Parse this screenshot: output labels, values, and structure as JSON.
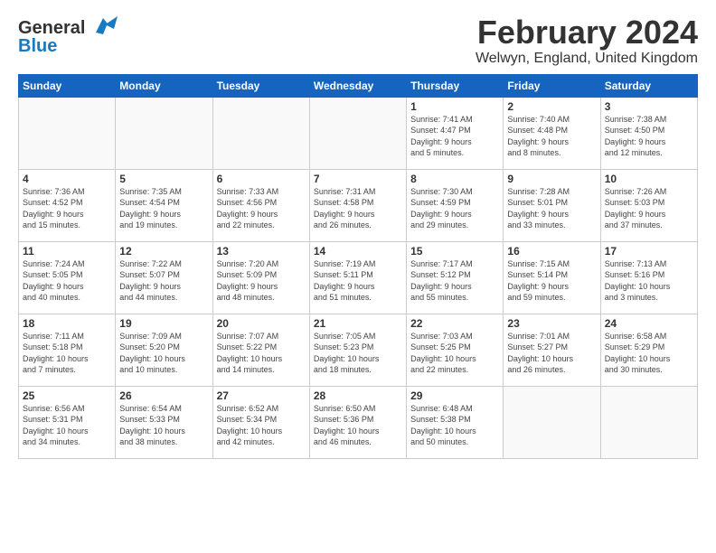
{
  "header": {
    "logo_general": "General",
    "logo_blue": "Blue",
    "month_title": "February 2024",
    "location": "Welwyn, England, United Kingdom"
  },
  "calendar": {
    "days_of_week": [
      "Sunday",
      "Monday",
      "Tuesday",
      "Wednesday",
      "Thursday",
      "Friday",
      "Saturday"
    ],
    "weeks": [
      [
        {
          "day": "",
          "info": ""
        },
        {
          "day": "",
          "info": ""
        },
        {
          "day": "",
          "info": ""
        },
        {
          "day": "",
          "info": ""
        },
        {
          "day": "1",
          "info": "Sunrise: 7:41 AM\nSunset: 4:47 PM\nDaylight: 9 hours\nand 5 minutes."
        },
        {
          "day": "2",
          "info": "Sunrise: 7:40 AM\nSunset: 4:48 PM\nDaylight: 9 hours\nand 8 minutes."
        },
        {
          "day": "3",
          "info": "Sunrise: 7:38 AM\nSunset: 4:50 PM\nDaylight: 9 hours\nand 12 minutes."
        }
      ],
      [
        {
          "day": "4",
          "info": "Sunrise: 7:36 AM\nSunset: 4:52 PM\nDaylight: 9 hours\nand 15 minutes."
        },
        {
          "day": "5",
          "info": "Sunrise: 7:35 AM\nSunset: 4:54 PM\nDaylight: 9 hours\nand 19 minutes."
        },
        {
          "day": "6",
          "info": "Sunrise: 7:33 AM\nSunset: 4:56 PM\nDaylight: 9 hours\nand 22 minutes."
        },
        {
          "day": "7",
          "info": "Sunrise: 7:31 AM\nSunset: 4:58 PM\nDaylight: 9 hours\nand 26 minutes."
        },
        {
          "day": "8",
          "info": "Sunrise: 7:30 AM\nSunset: 4:59 PM\nDaylight: 9 hours\nand 29 minutes."
        },
        {
          "day": "9",
          "info": "Sunrise: 7:28 AM\nSunset: 5:01 PM\nDaylight: 9 hours\nand 33 minutes."
        },
        {
          "day": "10",
          "info": "Sunrise: 7:26 AM\nSunset: 5:03 PM\nDaylight: 9 hours\nand 37 minutes."
        }
      ],
      [
        {
          "day": "11",
          "info": "Sunrise: 7:24 AM\nSunset: 5:05 PM\nDaylight: 9 hours\nand 40 minutes."
        },
        {
          "day": "12",
          "info": "Sunrise: 7:22 AM\nSunset: 5:07 PM\nDaylight: 9 hours\nand 44 minutes."
        },
        {
          "day": "13",
          "info": "Sunrise: 7:20 AM\nSunset: 5:09 PM\nDaylight: 9 hours\nand 48 minutes."
        },
        {
          "day": "14",
          "info": "Sunrise: 7:19 AM\nSunset: 5:11 PM\nDaylight: 9 hours\nand 51 minutes."
        },
        {
          "day": "15",
          "info": "Sunrise: 7:17 AM\nSunset: 5:12 PM\nDaylight: 9 hours\nand 55 minutes."
        },
        {
          "day": "16",
          "info": "Sunrise: 7:15 AM\nSunset: 5:14 PM\nDaylight: 9 hours\nand 59 minutes."
        },
        {
          "day": "17",
          "info": "Sunrise: 7:13 AM\nSunset: 5:16 PM\nDaylight: 10 hours\nand 3 minutes."
        }
      ],
      [
        {
          "day": "18",
          "info": "Sunrise: 7:11 AM\nSunset: 5:18 PM\nDaylight: 10 hours\nand 7 minutes."
        },
        {
          "day": "19",
          "info": "Sunrise: 7:09 AM\nSunset: 5:20 PM\nDaylight: 10 hours\nand 10 minutes."
        },
        {
          "day": "20",
          "info": "Sunrise: 7:07 AM\nSunset: 5:22 PM\nDaylight: 10 hours\nand 14 minutes."
        },
        {
          "day": "21",
          "info": "Sunrise: 7:05 AM\nSunset: 5:23 PM\nDaylight: 10 hours\nand 18 minutes."
        },
        {
          "day": "22",
          "info": "Sunrise: 7:03 AM\nSunset: 5:25 PM\nDaylight: 10 hours\nand 22 minutes."
        },
        {
          "day": "23",
          "info": "Sunrise: 7:01 AM\nSunset: 5:27 PM\nDaylight: 10 hours\nand 26 minutes."
        },
        {
          "day": "24",
          "info": "Sunrise: 6:58 AM\nSunset: 5:29 PM\nDaylight: 10 hours\nand 30 minutes."
        }
      ],
      [
        {
          "day": "25",
          "info": "Sunrise: 6:56 AM\nSunset: 5:31 PM\nDaylight: 10 hours\nand 34 minutes."
        },
        {
          "day": "26",
          "info": "Sunrise: 6:54 AM\nSunset: 5:33 PM\nDaylight: 10 hours\nand 38 minutes."
        },
        {
          "day": "27",
          "info": "Sunrise: 6:52 AM\nSunset: 5:34 PM\nDaylight: 10 hours\nand 42 minutes."
        },
        {
          "day": "28",
          "info": "Sunrise: 6:50 AM\nSunset: 5:36 PM\nDaylight: 10 hours\nand 46 minutes."
        },
        {
          "day": "29",
          "info": "Sunrise: 6:48 AM\nSunset: 5:38 PM\nDaylight: 10 hours\nand 50 minutes."
        },
        {
          "day": "",
          "info": ""
        },
        {
          "day": "",
          "info": ""
        }
      ]
    ]
  }
}
